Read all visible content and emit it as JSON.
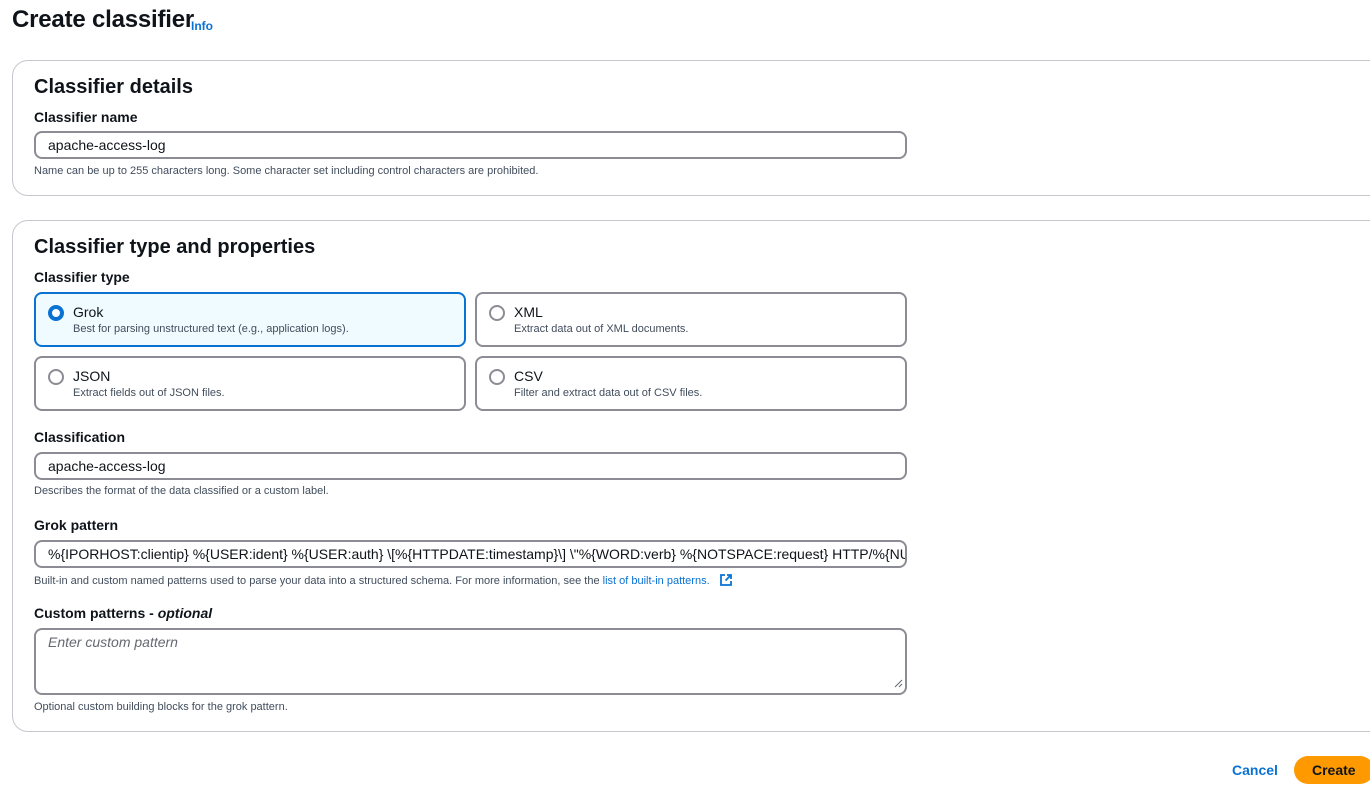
{
  "header": {
    "title": "Create classifier",
    "info_label": "Info"
  },
  "details": {
    "title": "Classifier details",
    "name_label": "Classifier name",
    "name_value": "apache-access-log",
    "name_help": "Name can be up to 255 characters long. Some character set including control characters are prohibited."
  },
  "props": {
    "title": "Classifier type and properties",
    "type_label": "Classifier type",
    "types": [
      {
        "label": "Grok",
        "desc": "Best for parsing unstructured text (e.g., application logs).",
        "selected": true
      },
      {
        "label": "XML",
        "desc": "Extract data out of XML documents.",
        "selected": false
      },
      {
        "label": "JSON",
        "desc": "Extract fields out of JSON files.",
        "selected": false
      },
      {
        "label": "CSV",
        "desc": "Filter and extract data out of CSV files.",
        "selected": false
      }
    ],
    "classification_label": "Classification",
    "classification_value": "apache-access-log",
    "classification_help": "Describes the format of the data classified or a custom label.",
    "grok_label": "Grok pattern",
    "grok_value": "%{IPORHOST:clientip} %{USER:ident} %{USER:auth} \\[%{HTTPDATE:timestamp}\\] \\\"%{WORD:verb} %{NOTSPACE:request} HTTP/%{NUMBER:httpversion}\\\"",
    "grok_help": "Built-in and custom named patterns used to parse your data into a structured schema. For more information, see the",
    "grok_help_link": "list of built-in patterns.",
    "custom_label": "Custom patterns - ",
    "custom_label_optional": "optional",
    "custom_placeholder": "Enter custom pattern",
    "custom_help": "Optional custom building blocks for the grok pattern."
  },
  "footer": {
    "cancel_label": "Cancel",
    "create_label": "Create"
  },
  "colors": {
    "accent": "#0972d3",
    "primary_button": "#ff9900",
    "selected_tile_bg": "#f0fbff"
  },
  "icons": {
    "external_link": "external-link-icon",
    "resize": "resize-grip-icon"
  }
}
